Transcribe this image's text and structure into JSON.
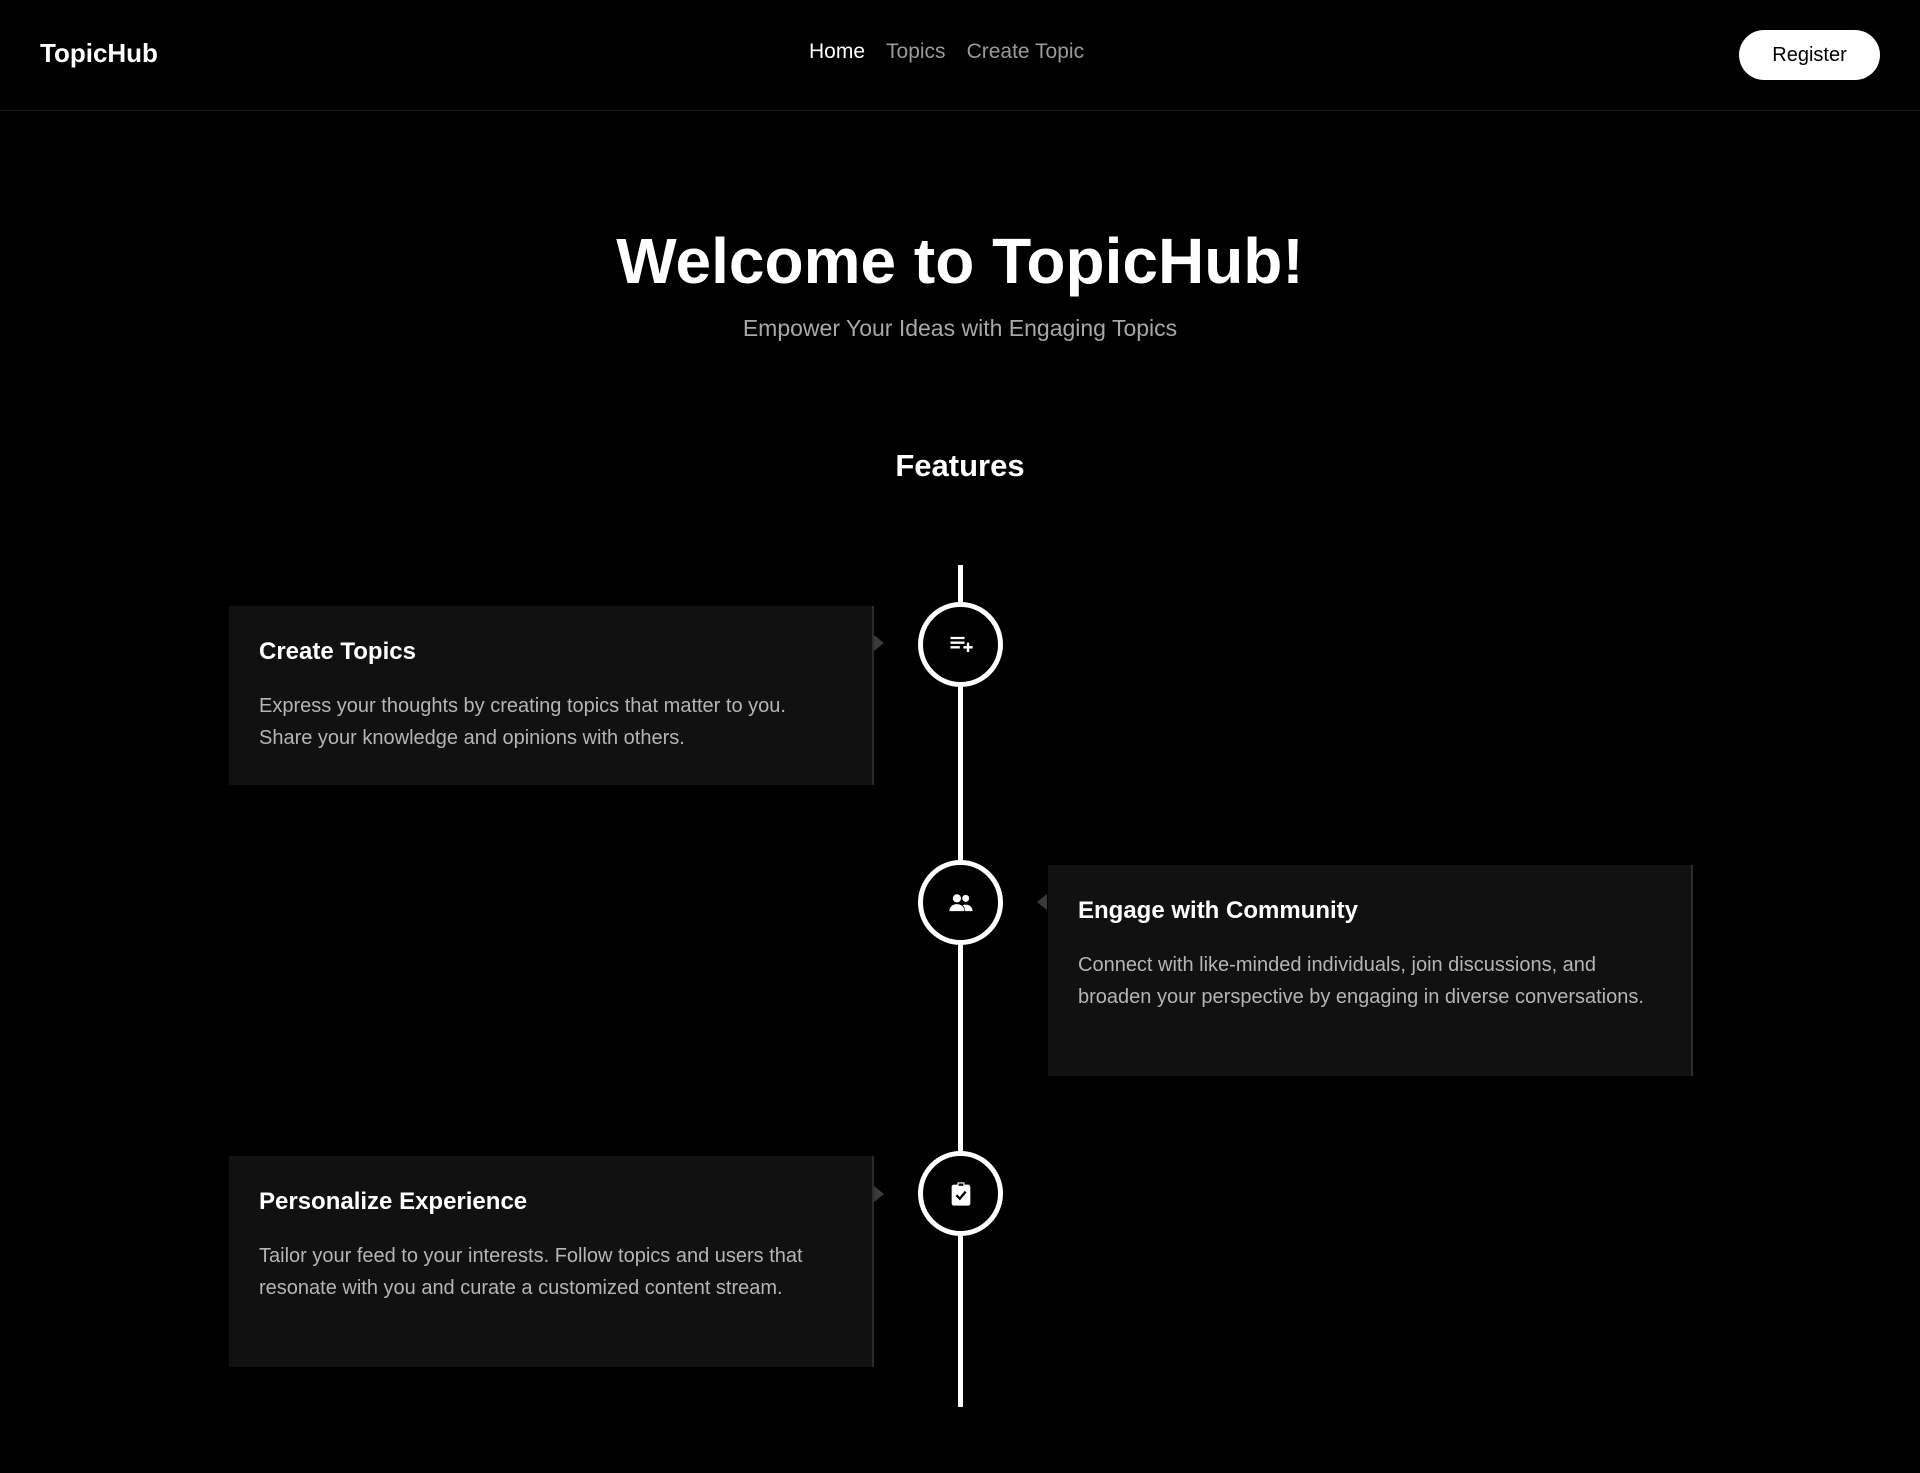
{
  "nav": {
    "brand": "TopicHub",
    "links": [
      {
        "label": "Home",
        "active": true
      },
      {
        "label": "Topics",
        "active": false
      },
      {
        "label": "Create Topic",
        "active": false
      }
    ],
    "register_label": "Register"
  },
  "hero": {
    "title": "Welcome to TopicHub!",
    "subtitle": "Empower Your Ideas with Engaging Topics"
  },
  "features": {
    "heading": "Features",
    "items": [
      {
        "title": "Create Topics",
        "description": "Express your thoughts by creating topics that matter to you. Share your knowledge and opinions with others.",
        "icon": "playlist-add-icon",
        "side": "left"
      },
      {
        "title": "Engage with Community",
        "description": "Connect with like-minded individuals, join discussions, and broaden your perspective by engaging in diverse conversations.",
        "icon": "people-icon",
        "side": "right"
      },
      {
        "title": "Personalize Experience",
        "description": "Tailor your feed to your interests. Follow topics and users that resonate with you and curate a customized content stream.",
        "icon": "clipboard-check-icon",
        "side": "left"
      }
    ]
  },
  "colors": {
    "background": "#000000",
    "card": "#111111",
    "text": "#ffffff",
    "muted": "#9a9a9a"
  }
}
